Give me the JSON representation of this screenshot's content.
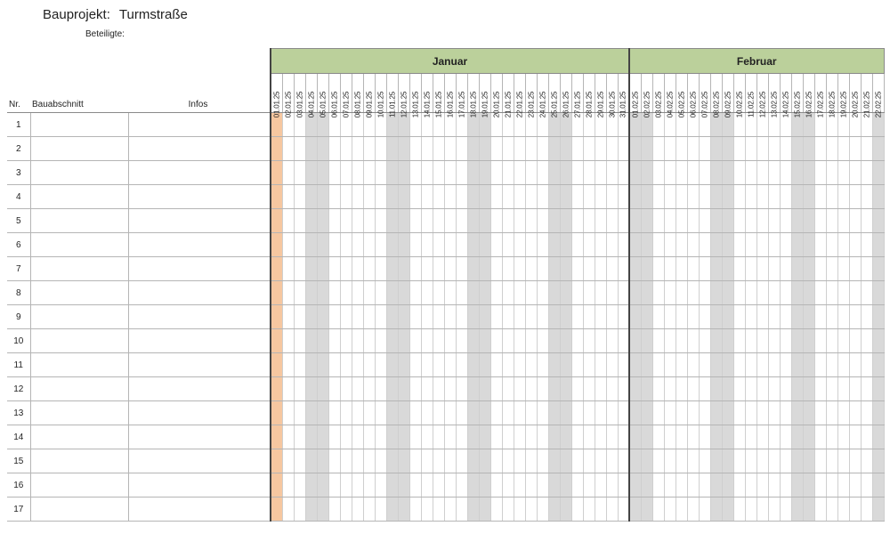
{
  "header": {
    "project_label": "Bauprojekt:",
    "project_name": "Turmstraße",
    "participants_label": "Beteiligte:"
  },
  "columns": {
    "nr": "Nr.",
    "section": "Bauabschnitt",
    "info": "Infos"
  },
  "months": [
    "Januar",
    "Februar"
  ],
  "today": "01.01.25",
  "dates": [
    {
      "label": "01.01.25",
      "month": 0,
      "weekend": false
    },
    {
      "label": "02.01.25",
      "month": 0,
      "weekend": false
    },
    {
      "label": "03.01.25",
      "month": 0,
      "weekend": false
    },
    {
      "label": "04.01.25",
      "month": 0,
      "weekend": true
    },
    {
      "label": "05.01.25",
      "month": 0,
      "weekend": true
    },
    {
      "label": "06.01.25",
      "month": 0,
      "weekend": false
    },
    {
      "label": "07.01.25",
      "month": 0,
      "weekend": false
    },
    {
      "label": "08.01.25",
      "month": 0,
      "weekend": false
    },
    {
      "label": "09.01.25",
      "month": 0,
      "weekend": false
    },
    {
      "label": "10.01.25",
      "month": 0,
      "weekend": false
    },
    {
      "label": "11.01.25",
      "month": 0,
      "weekend": true
    },
    {
      "label": "12.01.25",
      "month": 0,
      "weekend": true
    },
    {
      "label": "13.01.25",
      "month": 0,
      "weekend": false
    },
    {
      "label": "14.01.25",
      "month": 0,
      "weekend": false
    },
    {
      "label": "15.01.25",
      "month": 0,
      "weekend": false
    },
    {
      "label": "16.01.25",
      "month": 0,
      "weekend": false
    },
    {
      "label": "17.01.25",
      "month": 0,
      "weekend": false
    },
    {
      "label": "18.01.25",
      "month": 0,
      "weekend": true
    },
    {
      "label": "19.01.25",
      "month": 0,
      "weekend": true
    },
    {
      "label": "20.01.25",
      "month": 0,
      "weekend": false
    },
    {
      "label": "21.01.25",
      "month": 0,
      "weekend": false
    },
    {
      "label": "22.01.25",
      "month": 0,
      "weekend": false
    },
    {
      "label": "23.01.25",
      "month": 0,
      "weekend": false
    },
    {
      "label": "24.01.25",
      "month": 0,
      "weekend": false
    },
    {
      "label": "25.01.25",
      "month": 0,
      "weekend": true
    },
    {
      "label": "26.01.25",
      "month": 0,
      "weekend": true
    },
    {
      "label": "27.01.25",
      "month": 0,
      "weekend": false
    },
    {
      "label": "28.01.25",
      "month": 0,
      "weekend": false
    },
    {
      "label": "29.01.25",
      "month": 0,
      "weekend": false
    },
    {
      "label": "30.01.25",
      "month": 0,
      "weekend": false
    },
    {
      "label": "31.01.25",
      "month": 0,
      "weekend": false
    },
    {
      "label": "01.02.25",
      "month": 1,
      "weekend": true
    },
    {
      "label": "02.02.25",
      "month": 1,
      "weekend": true
    },
    {
      "label": "03.02.25",
      "month": 1,
      "weekend": false
    },
    {
      "label": "04.02.25",
      "month": 1,
      "weekend": false
    },
    {
      "label": "05.02.25",
      "month": 1,
      "weekend": false
    },
    {
      "label": "06.02.25",
      "month": 1,
      "weekend": false
    },
    {
      "label": "07.02.25",
      "month": 1,
      "weekend": false
    },
    {
      "label": "08.02.25",
      "month": 1,
      "weekend": true
    },
    {
      "label": "09.02.25",
      "month": 1,
      "weekend": true
    },
    {
      "label": "10.02.25",
      "month": 1,
      "weekend": false
    },
    {
      "label": "11.02.25",
      "month": 1,
      "weekend": false
    },
    {
      "label": "12.02.25",
      "month": 1,
      "weekend": false
    },
    {
      "label": "13.02.25",
      "month": 1,
      "weekend": false
    },
    {
      "label": "14.02.25",
      "month": 1,
      "weekend": false
    },
    {
      "label": "15.02.25",
      "month": 1,
      "weekend": true
    },
    {
      "label": "16.02.25",
      "month": 1,
      "weekend": true
    },
    {
      "label": "17.02.25",
      "month": 1,
      "weekend": false
    },
    {
      "label": "18.02.25",
      "month": 1,
      "weekend": false
    },
    {
      "label": "19.02.25",
      "month": 1,
      "weekend": false
    },
    {
      "label": "20.02.25",
      "month": 1,
      "weekend": false
    },
    {
      "label": "21.02.25",
      "month": 1,
      "weekend": false
    },
    {
      "label": "22.02.25",
      "month": 1,
      "weekend": true
    }
  ],
  "rows": [
    {
      "nr": "1",
      "section": "",
      "info": ""
    },
    {
      "nr": "2",
      "section": "",
      "info": ""
    },
    {
      "nr": "3",
      "section": "",
      "info": ""
    },
    {
      "nr": "4",
      "section": "",
      "info": ""
    },
    {
      "nr": "5",
      "section": "",
      "info": ""
    },
    {
      "nr": "6",
      "section": "",
      "info": ""
    },
    {
      "nr": "7",
      "section": "",
      "info": ""
    },
    {
      "nr": "8",
      "section": "",
      "info": ""
    },
    {
      "nr": "9",
      "section": "",
      "info": ""
    },
    {
      "nr": "10",
      "section": "",
      "info": ""
    },
    {
      "nr": "11",
      "section": "",
      "info": ""
    },
    {
      "nr": "12",
      "section": "",
      "info": ""
    },
    {
      "nr": "13",
      "section": "",
      "info": ""
    },
    {
      "nr": "14",
      "section": "",
      "info": ""
    },
    {
      "nr": "15",
      "section": "",
      "info": ""
    },
    {
      "nr": "16",
      "section": "",
      "info": ""
    },
    {
      "nr": "17",
      "section": "",
      "info": ""
    }
  ]
}
